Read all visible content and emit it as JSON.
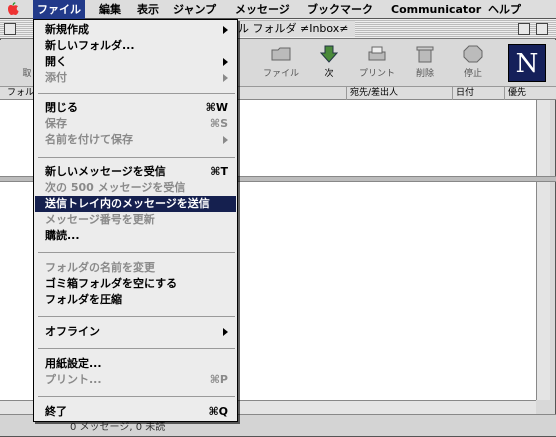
{
  "menubar": {
    "items": [
      "ファイル",
      "編集",
      "表示",
      "ジャンプ",
      "メッセージ",
      "ブックマーク",
      "Communicator",
      "ヘルプ"
    ]
  },
  "window": {
    "title": "ル フォルダ ≠Inbox≠"
  },
  "toolbar": {
    "buttons": [
      "取",
      "ファイル",
      "次",
      "プリント",
      "削除",
      "停止"
    ]
  },
  "columns": {
    "folder": "フォル",
    "sender": "宛先/差出人",
    "date": "日付",
    "priority": "優先"
  },
  "status": {
    "text": "0 メッセージ, 0 未読"
  },
  "file_menu": {
    "items": [
      {
        "label": "新規作成",
        "shortcut": "",
        "submenu": true,
        "disabled": false
      },
      {
        "label": "新しいフォルダ...",
        "shortcut": "",
        "submenu": false,
        "disabled": false
      },
      {
        "label": "開く",
        "shortcut": "",
        "submenu": true,
        "disabled": false
      },
      {
        "label": "添付",
        "shortcut": "",
        "submenu": true,
        "disabled": true
      },
      {
        "label": "閉じる",
        "shortcut": "⌘W",
        "submenu": false,
        "disabled": false
      },
      {
        "label": "保存",
        "shortcut": "⌘S",
        "submenu": false,
        "disabled": true
      },
      {
        "label": "名前を付けて保存",
        "shortcut": "",
        "submenu": true,
        "disabled": true
      },
      {
        "label": "新しいメッセージを受信",
        "shortcut": "⌘T",
        "submenu": false,
        "disabled": false
      },
      {
        "label": "次の 500 メッセージを受信",
        "shortcut": "",
        "submenu": false,
        "disabled": true
      },
      {
        "label": "送信トレイ内のメッセージを送信",
        "shortcut": "",
        "submenu": false,
        "disabled": false,
        "highlighted": true
      },
      {
        "label": "メッセージ番号を更新",
        "shortcut": "",
        "submenu": false,
        "disabled": true
      },
      {
        "label": "購読...",
        "shortcut": "",
        "submenu": false,
        "disabled": false
      },
      {
        "label": "フォルダの名前を変更",
        "shortcut": "",
        "submenu": false,
        "disabled": true
      },
      {
        "label": "ゴミ箱フォルダを空にする",
        "shortcut": "",
        "submenu": false,
        "disabled": false
      },
      {
        "label": "フォルダを圧縮",
        "shortcut": "",
        "submenu": false,
        "disabled": false
      },
      {
        "label": "オフライン",
        "shortcut": "",
        "submenu": true,
        "disabled": false
      },
      {
        "label": "用紙設定...",
        "shortcut": "",
        "submenu": false,
        "disabled": false
      },
      {
        "label": "プリント...",
        "shortcut": "⌘P",
        "submenu": false,
        "disabled": true
      },
      {
        "label": "終了",
        "shortcut": "⌘Q",
        "submenu": false,
        "disabled": false
      }
    ]
  },
  "logo": {
    "letter": "N"
  }
}
